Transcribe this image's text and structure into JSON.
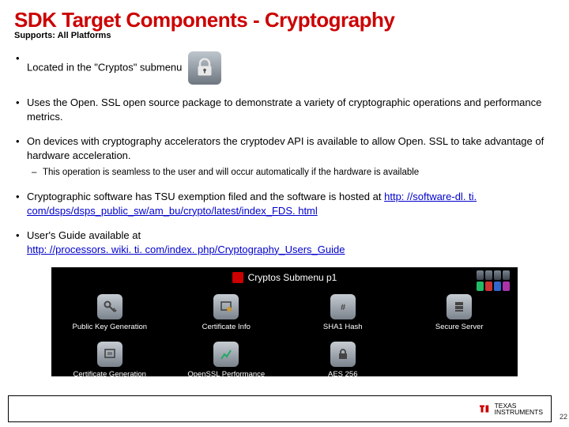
{
  "title": "SDK Target Components - Cryptography",
  "subtitle": "Supports: All Platforms",
  "bullets": {
    "b1": "Located in the \"Cryptos\" submenu",
    "b2": "Uses the Open. SSL open source package to demonstrate a variety of cryptographic operations and performance metrics.",
    "b3": "On devices with cryptography accelerators the cryptodev API is available to allow Open. SSL to take advantage of hardware acceleration.",
    "b3sub": "This operation is seamless to the user and will occur automatically if the hardware is available",
    "b4a": "Cryptographic software has TSU exemption filed and the software is hosted at ",
    "b4link": "http: //software-dl. ti. com/dsps/dsps_public_sw/am_bu/crypto/latest/index_FDS. html",
    "b5a": "User's Guide available at ",
    "b5link": "http: //processors. wiki. ti. com/index. php/Cryptography_Users_Guide"
  },
  "submenu": {
    "header": "Cryptos Submenu p1",
    "items": [
      "Public Key Generation",
      "Certificate Info",
      "SHA1 Hash",
      "Secure Server",
      "Certificate Generation",
      "OpenSSL Performance",
      "AES 256"
    ]
  },
  "footer": {
    "brand1": "TEXAS",
    "brand2": "INSTRUMENTS"
  },
  "pagenum": "22"
}
